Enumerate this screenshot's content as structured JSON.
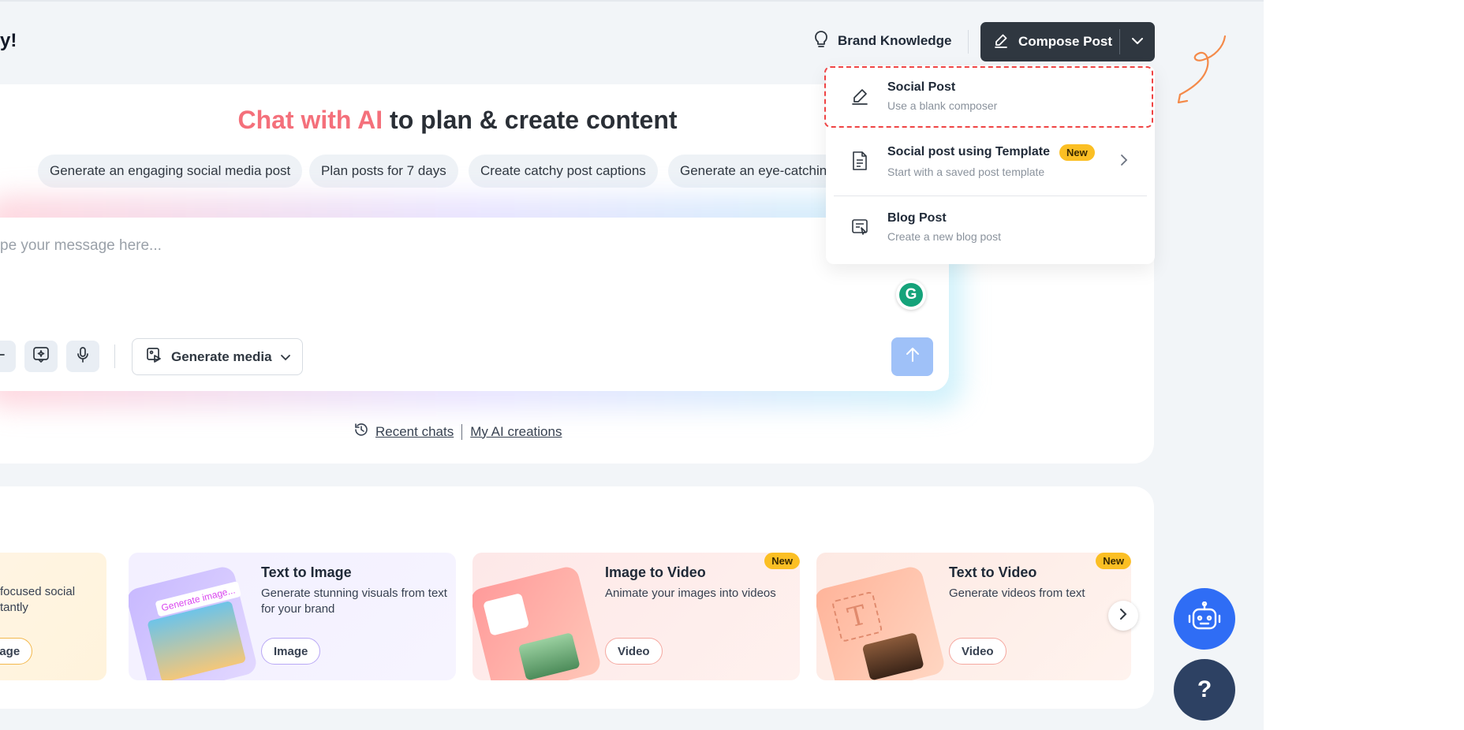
{
  "header": {
    "greeting": "y!",
    "brand_knowledge": "Brand Knowledge",
    "compose_post": "Compose Post"
  },
  "compose_menu": {
    "items": [
      {
        "title": "Social Post",
        "subtitle": "Use a blank composer",
        "icon": "pencil-icon"
      },
      {
        "title": "Social post using Template",
        "subtitle": "Start with a saved post template",
        "badge": "New",
        "icon": "document-icon"
      },
      {
        "title": "Blog Post",
        "subtitle": "Create a new blog post",
        "icon": "blog-icon"
      }
    ]
  },
  "chat": {
    "heading_part1": "Chat with AI",
    "heading_part2": "to plan & create content",
    "suggestions": [
      "Generate an engaging social media post",
      "Plan posts for 7 days",
      "Create catchy post captions",
      "Generate an eye-catching"
    ],
    "input_placeholder": "pe your message here...",
    "generate_media": "Generate media",
    "recent_chats": "Recent chats",
    "my_ai_creations": "My AI creations"
  },
  "features": [
    {
      "title": "",
      "description": "focused social\ntantly",
      "button": "mage",
      "new": ""
    },
    {
      "title": "Text to Image",
      "description": "Generate stunning visuals from text for your brand",
      "button": "Image",
      "new": "",
      "thumb_text": "Generate image..."
    },
    {
      "title": "Image to Video",
      "description": "Animate your images into videos",
      "button": "Video",
      "new": "New"
    },
    {
      "title": "Text to Video",
      "description": "Generate videos from text",
      "button": "Video",
      "new": "New"
    }
  ],
  "floating": {
    "help": "?"
  },
  "colors": {
    "compose_bg": "#2f3740",
    "accent_blue": "#2f6df5",
    "highlight_dashed": "#ef4444",
    "new_badge": "#fbbf24"
  }
}
